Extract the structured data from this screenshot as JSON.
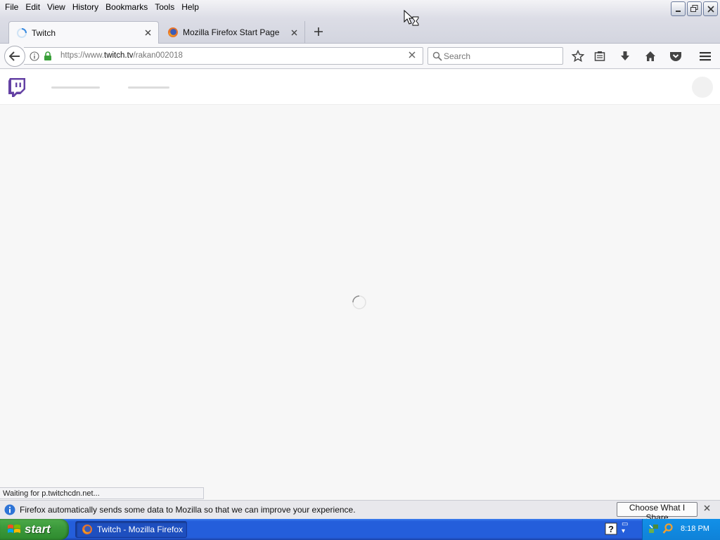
{
  "menubar": {
    "items": [
      "File",
      "Edit",
      "View",
      "History",
      "Bookmarks",
      "Tools",
      "Help"
    ]
  },
  "window_controls": [
    "minimize-icon",
    "restore-icon",
    "close-icon"
  ],
  "tabs": [
    {
      "title": "Twitch",
      "icon": "loading-spinner-icon",
      "active": true
    },
    {
      "title": "Mozilla Firefox Start Page",
      "icon": "firefox-icon",
      "active": false
    }
  ],
  "navbar": {
    "url_prefix": "https://www.",
    "url_host": "twitch.tv",
    "url_path": "/rakan002018",
    "search_placeholder": "Search",
    "toolbar_icons": [
      "bookmark-star-icon",
      "reading-list-icon",
      "download-icon",
      "home-icon",
      "pocket-icon",
      "hamburger-menu-icon"
    ]
  },
  "page": {
    "site": "Twitch",
    "loading": true,
    "brand_color": "#6441a4"
  },
  "status": {
    "text": "Waiting for p.twitchcdn.net..."
  },
  "notification": {
    "text": "Firefox automatically sends some data to Mozilla so that we can improve your experience.",
    "button": "Choose What I Share"
  },
  "taskbar": {
    "start_label": "start",
    "task_label": "Twitch - Mozilla Firefox",
    "clock": "8:18 PM"
  }
}
